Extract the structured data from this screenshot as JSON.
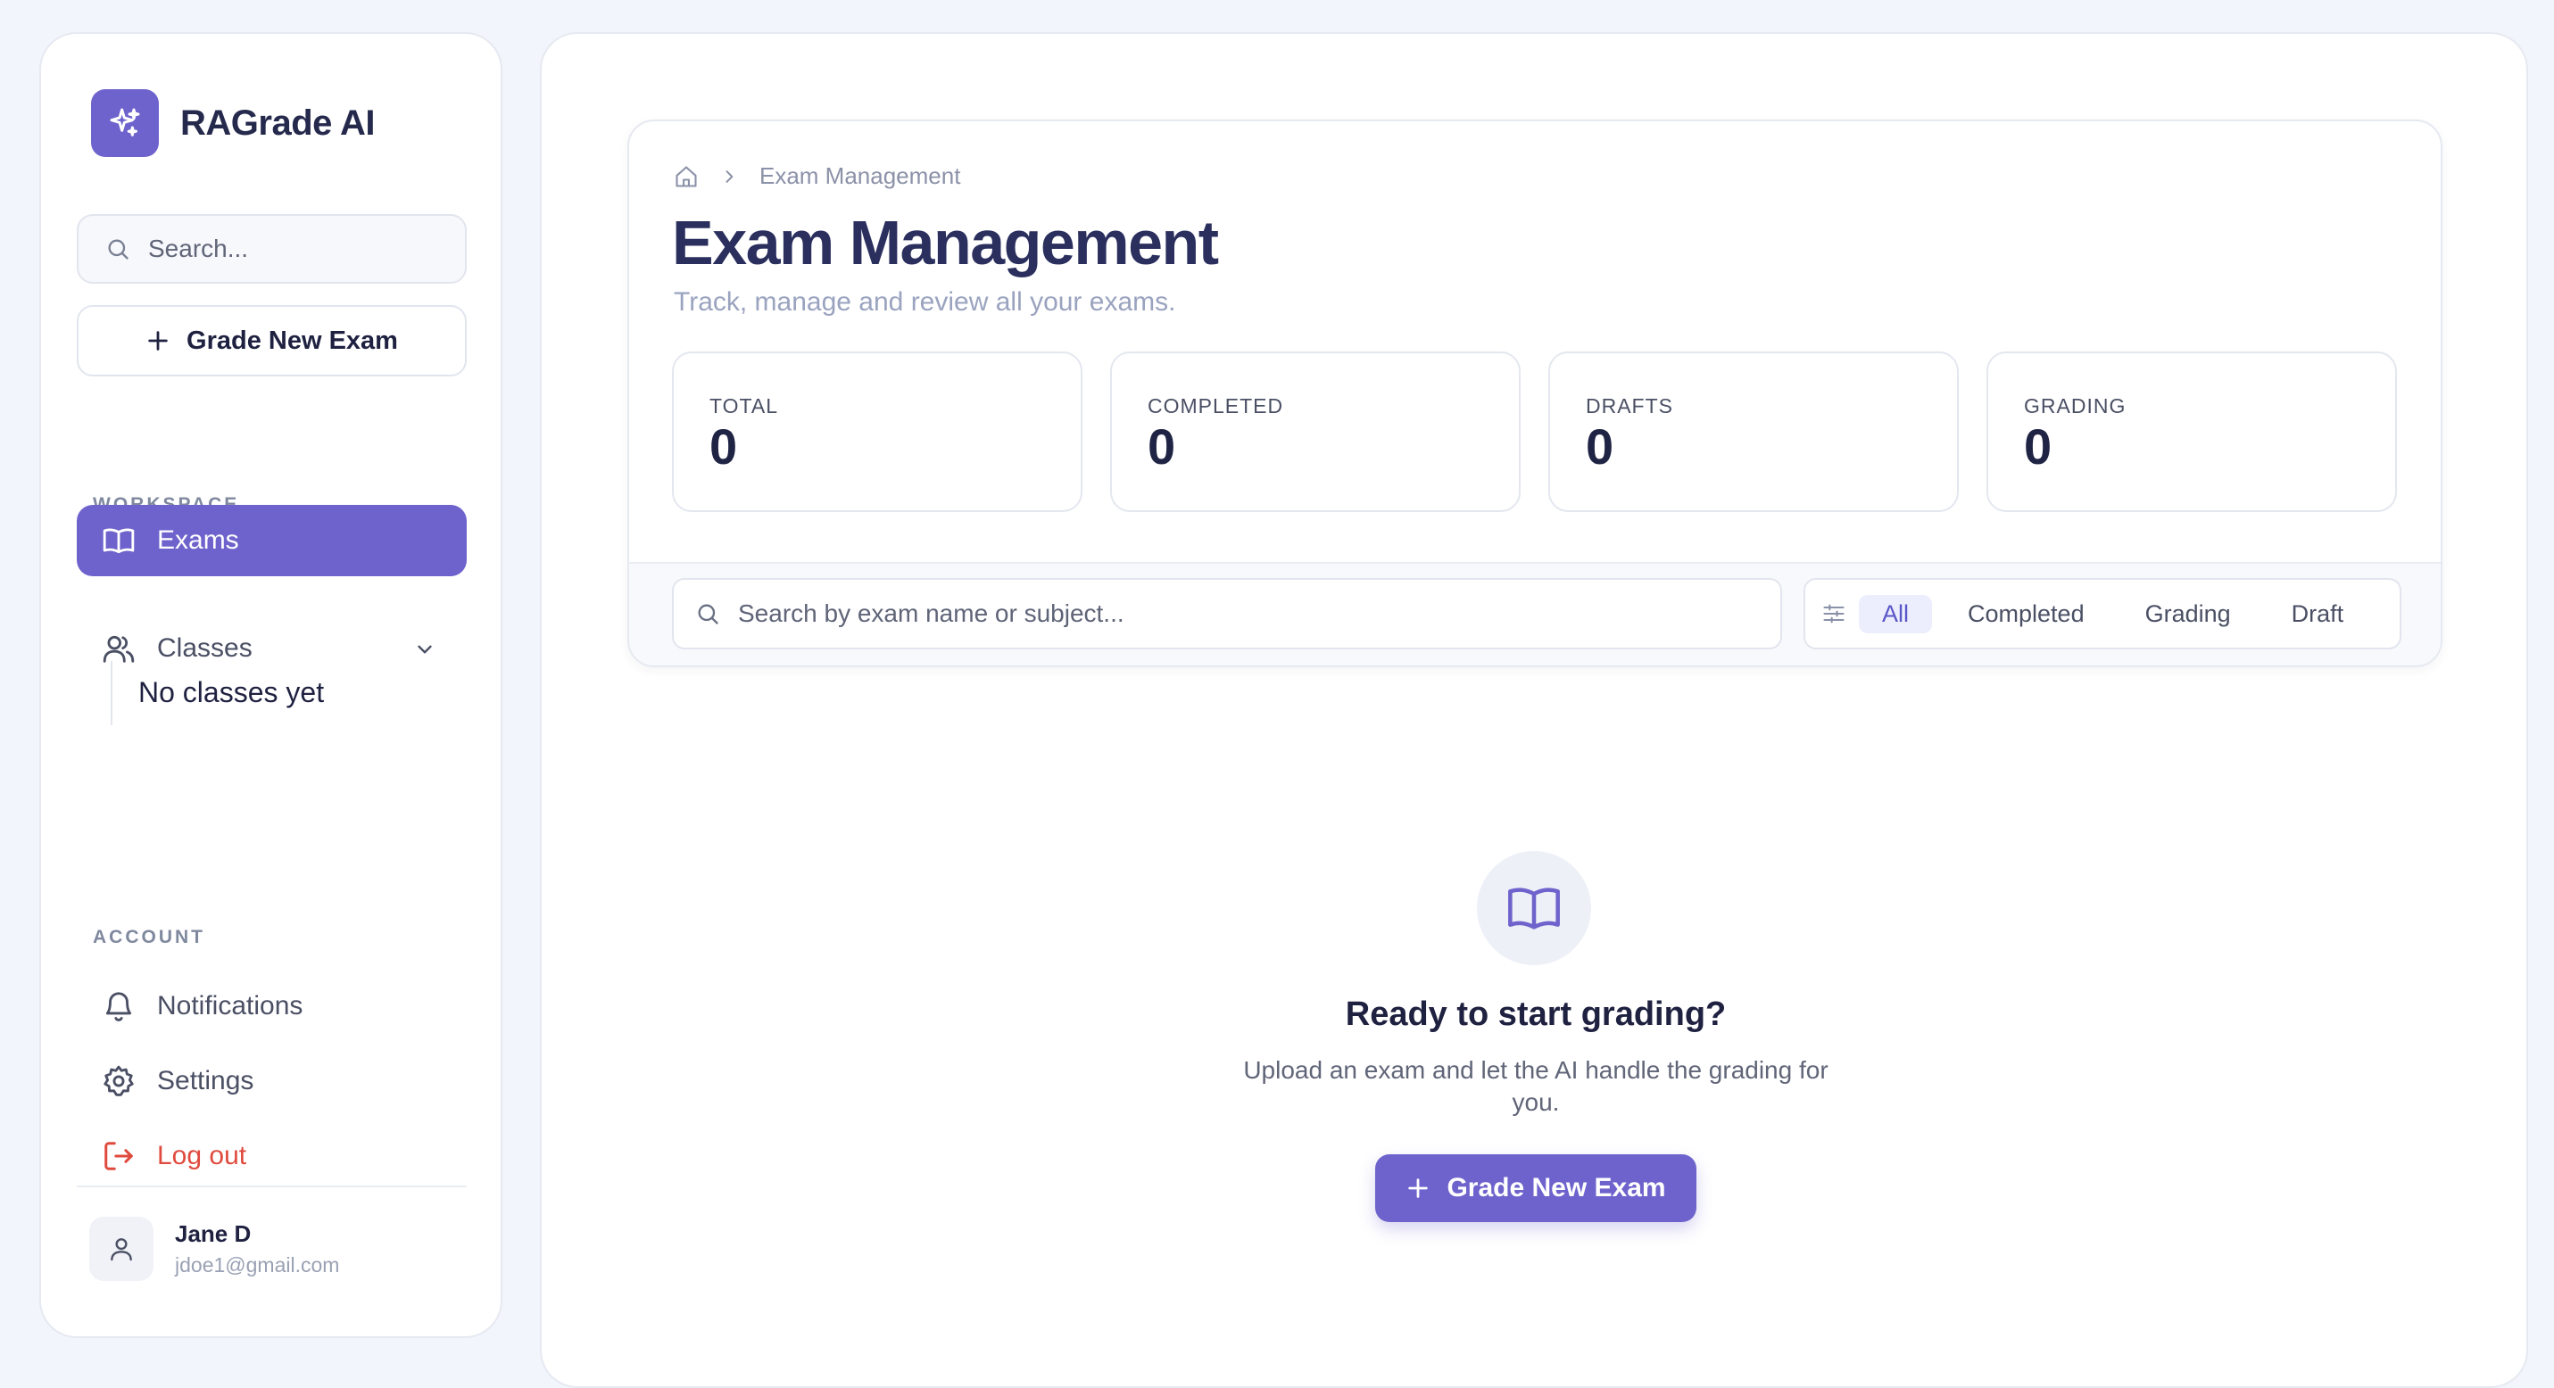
{
  "brand": {
    "name": "RAGrade AI"
  },
  "sidebar": {
    "search_placeholder": "Search...",
    "new_exam_label": "Grade New Exam",
    "workspace_label": "WORKSPACE",
    "workspace_items": [
      {
        "label": "Exams",
        "icon": "book-icon",
        "active": true
      },
      {
        "label": "Classes",
        "icon": "users-icon",
        "expandable": true
      }
    ],
    "classes_empty": "No classes yet",
    "account_label": "ACCOUNT",
    "account_items": [
      {
        "label": "Notifications",
        "icon": "bell-icon"
      },
      {
        "label": "Settings",
        "icon": "gear-icon"
      },
      {
        "label": "Log out",
        "icon": "logout-icon",
        "color": "#e04a3e"
      }
    ],
    "user": {
      "name": "Jane D",
      "email": "jdoe1@gmail.com"
    }
  },
  "header": {
    "breadcrumb": [
      "home-icon",
      "Exam Management"
    ],
    "title": "Exam Management",
    "subtitle": "Track, manage and review all your exams."
  },
  "stats": [
    {
      "label": "TOTAL",
      "value": "0"
    },
    {
      "label": "COMPLETED",
      "value": "0"
    },
    {
      "label": "DRAFTS",
      "value": "0"
    },
    {
      "label": "GRADING",
      "value": "0"
    }
  ],
  "filters": {
    "search_placeholder": "Search by exam name or subject...",
    "tabs": [
      "All",
      "Completed",
      "Grading",
      "Draft"
    ],
    "active_tab": "All"
  },
  "empty_state": {
    "icon": "book-icon",
    "title": "Ready to start grading?",
    "subtitle": "Upload an exam and let the AI handle the grading for you.",
    "cta_label": "Grade New Exam"
  },
  "colors": {
    "accent": "#6e63cc",
    "background": "#f2f5fb",
    "danger": "#e04a3e",
    "title": "#2b2f5e"
  }
}
